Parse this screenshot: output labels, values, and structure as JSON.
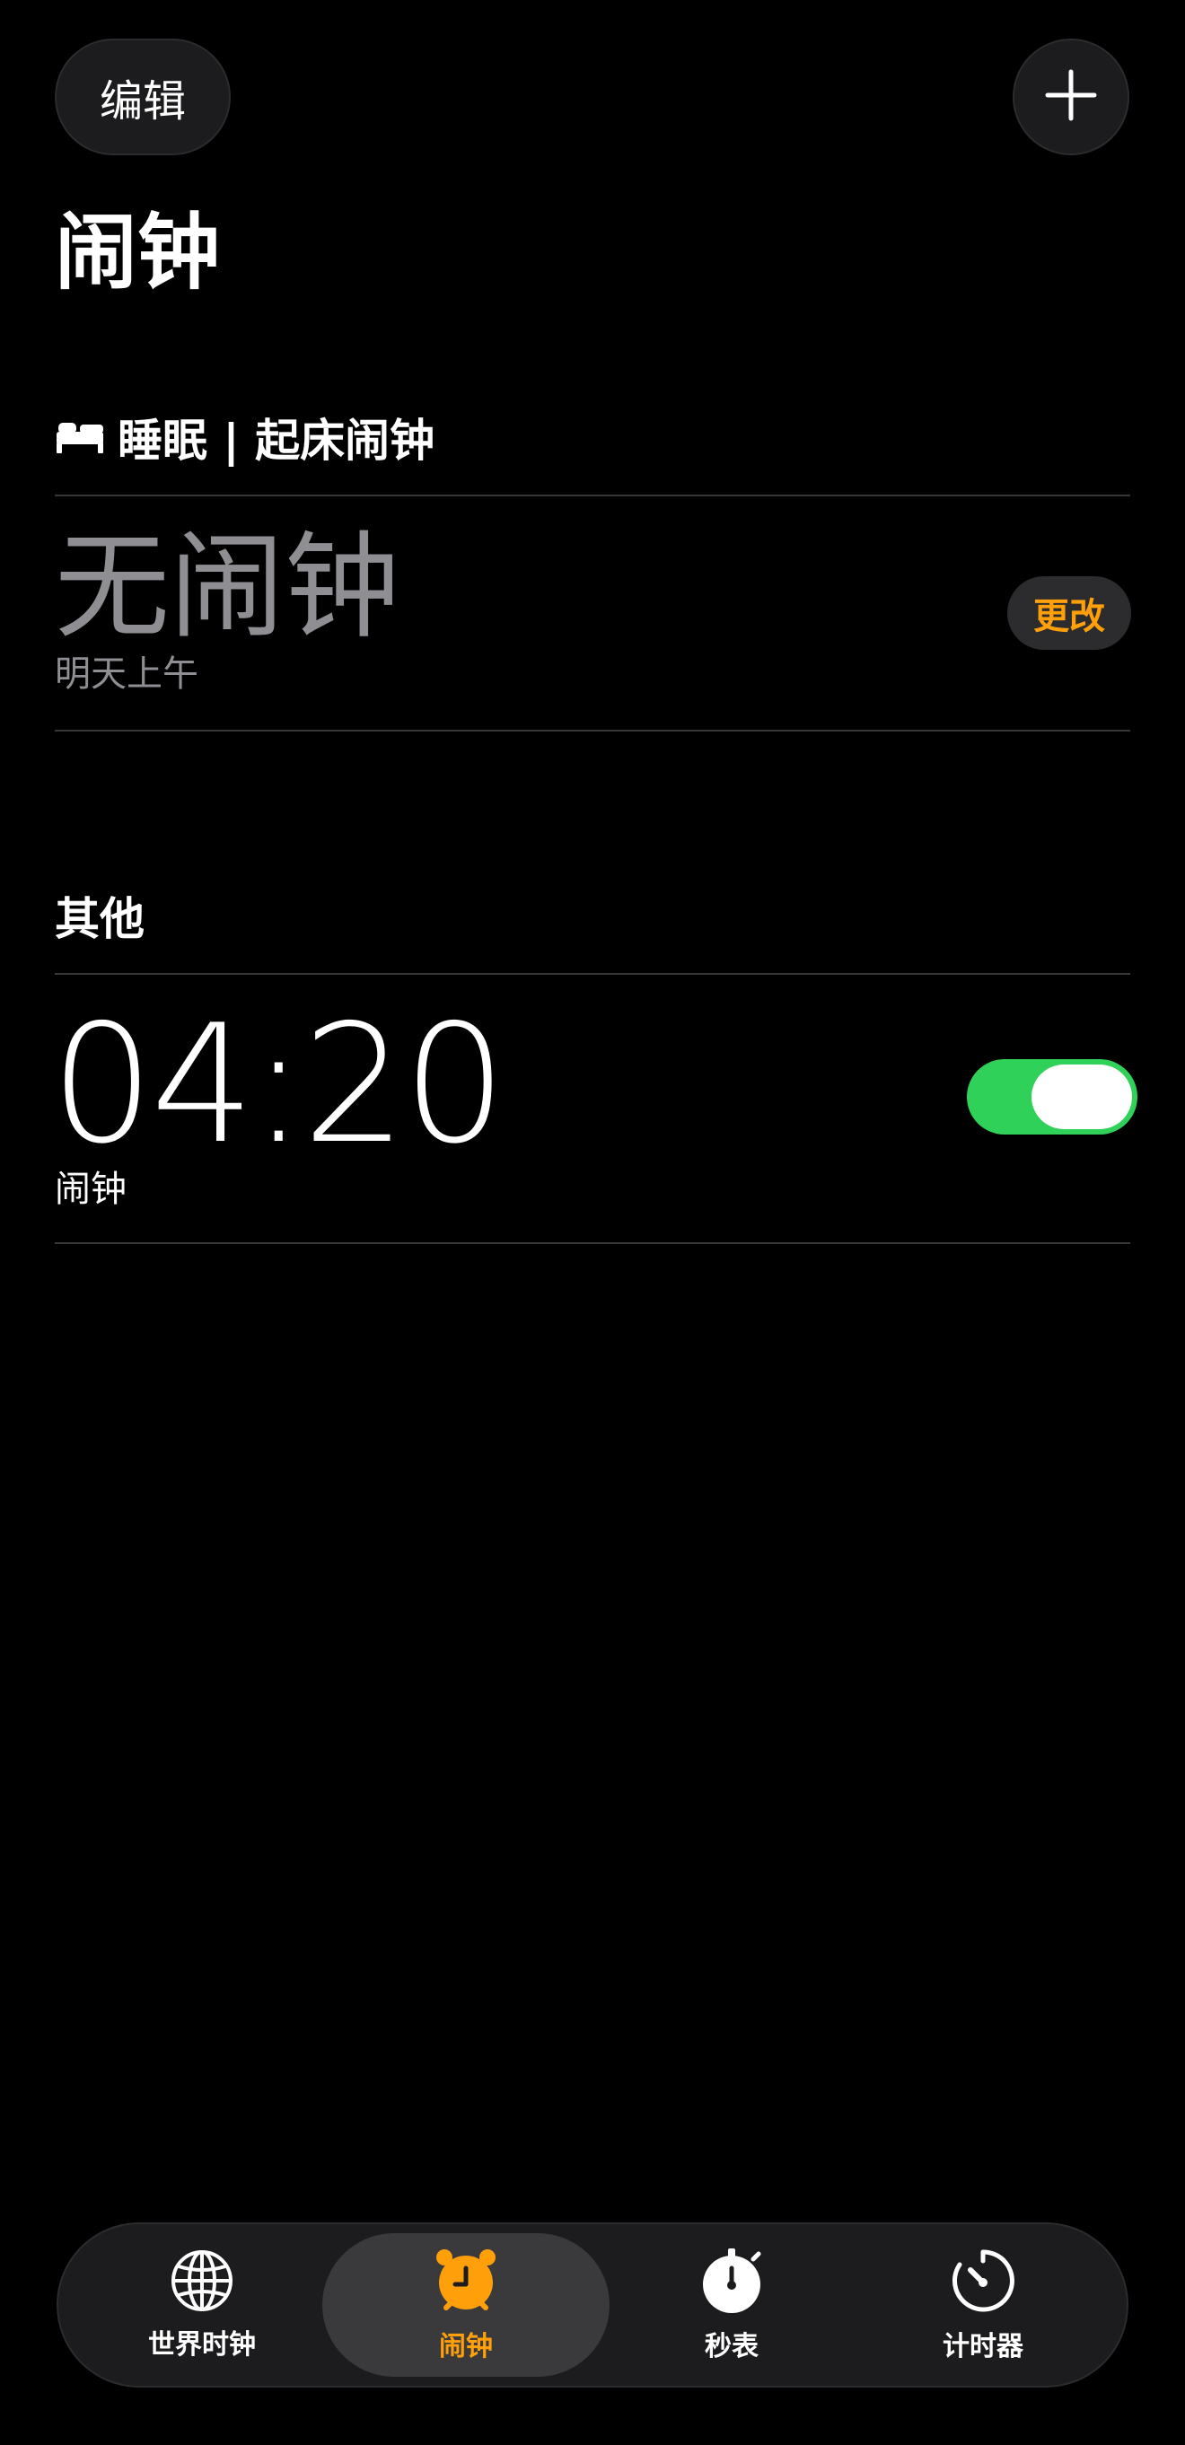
{
  "header": {
    "edit_label": "编辑",
    "title": "闹钟"
  },
  "sleep_section": {
    "title": "睡眠 | 起床闹钟",
    "no_alarm_text": "无闹钟",
    "subtitle": "明天上午",
    "change_label": "更改"
  },
  "other_section": {
    "title": "其他",
    "alarms": [
      {
        "time": "04:20",
        "label": "闹钟",
        "enabled": true
      }
    ]
  },
  "tab_bar": {
    "tabs": [
      {
        "label": "世界时钟",
        "icon": "globe-icon",
        "selected": false
      },
      {
        "label": "闹钟",
        "icon": "alarm-clock-icon",
        "selected": true
      },
      {
        "label": "秒表",
        "icon": "stopwatch-icon",
        "selected": false
      },
      {
        "label": "计时器",
        "icon": "timer-icon",
        "selected": false
      }
    ]
  },
  "colors": {
    "accent": "#ff9f0a",
    "toggle_on": "#30d158",
    "background": "#000000",
    "secondary_text": "#8e8e93"
  }
}
